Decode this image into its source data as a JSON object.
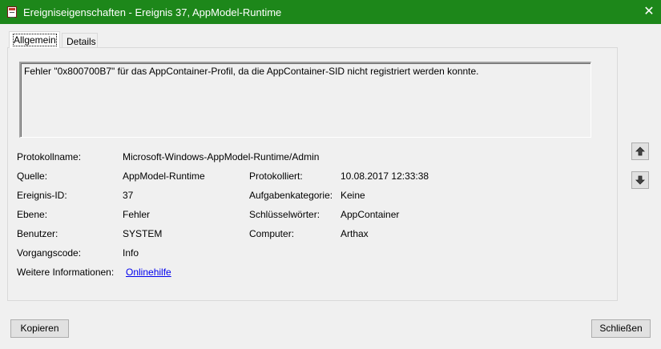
{
  "window": {
    "title": "Ereigniseigenschaften - Ereignis 37, AppModel-Runtime",
    "close_glyph": "✕",
    "icon": "event-viewer-icon",
    "titlebar_color": "#1d871a"
  },
  "tabs": [
    {
      "label": "Allgemein",
      "active": true
    },
    {
      "label": "Details",
      "active": false
    }
  ],
  "message": "Fehler \"0x800700B7\" für das AppContainer-Profil, da die AppContainer-SID nicht registriert werden konnte.",
  "fields": {
    "protokollname": {
      "label": "Protokollname:",
      "value": "Microsoft-Windows-AppModel-Runtime/Admin"
    },
    "quelle": {
      "label": "Quelle:",
      "value": "AppModel-Runtime"
    },
    "protokolliert": {
      "label": "Protokolliert:",
      "value": "10.08.2017 12:33:38"
    },
    "ereignis_id": {
      "label": "Ereignis-ID:",
      "value": "37"
    },
    "aufgabenkategorie": {
      "label": "Aufgabenkategorie:",
      "value": "Keine"
    },
    "ebene": {
      "label": "Ebene:",
      "value": "Fehler"
    },
    "schluesselwoerter": {
      "label": "Schlüsselwörter:",
      "value": "AppContainer"
    },
    "benutzer": {
      "label": "Benutzer:",
      "value": "SYSTEM"
    },
    "computer": {
      "label": "Computer:",
      "value": "Arthax"
    },
    "vorgangscode": {
      "label": "Vorgangscode:",
      "value": "Info"
    },
    "weitere_informationen": {
      "label": "Weitere Informationen:",
      "value": "Onlinehilfe"
    }
  },
  "side_buttons": {
    "up_icon": "arrow-up-icon",
    "down_icon": "arrow-down-icon"
  },
  "buttons": {
    "copy": "Kopieren",
    "close": "Schließen"
  }
}
